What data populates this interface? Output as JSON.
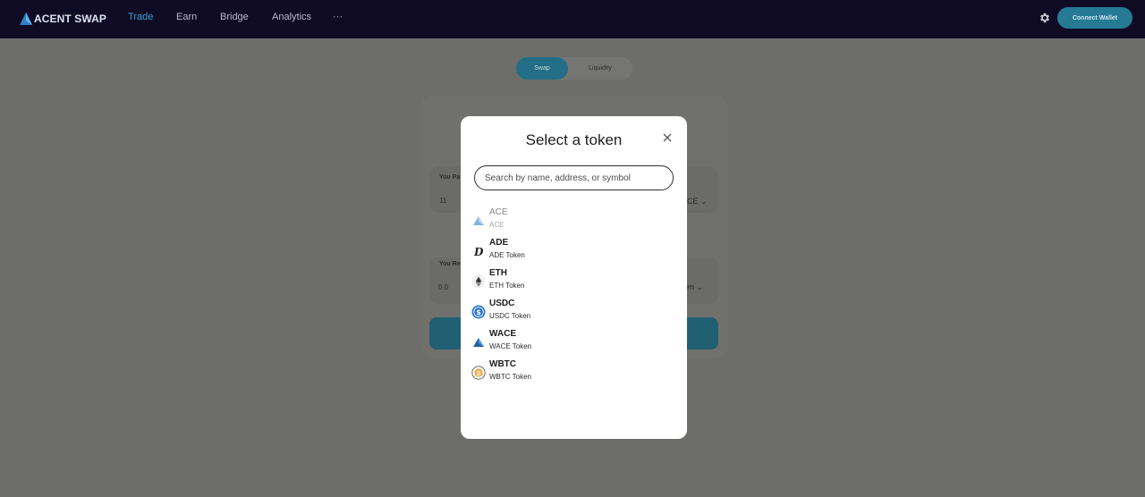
{
  "brand": {
    "name": "ACENT SWAP",
    "accent": "#3aa0d6"
  },
  "nav": {
    "links": [
      {
        "label": "Trade",
        "active": true
      },
      {
        "label": "Earn",
        "active": false
      },
      {
        "label": "Bridge",
        "active": false
      },
      {
        "label": "Analytics",
        "active": false
      },
      {
        "label": "···",
        "active": false
      }
    ],
    "connect_label": "Connect Wallet"
  },
  "page": {
    "tabs": [
      {
        "label": "Swap",
        "active": true
      },
      {
        "label": "Liquidity",
        "active": false
      }
    ],
    "pay_label": "You Pa",
    "pay_value": "11",
    "pay_token": "CE",
    "receive_label": "You Re",
    "receive_value": "0.0",
    "receive_token": "en"
  },
  "modal": {
    "title": "Select a token",
    "search_placeholder": "Search by name, address, or symbol",
    "tokens": [
      {
        "symbol": "ACE",
        "name": "ACE",
        "icon": "ace-icon",
        "disabled": true
      },
      {
        "symbol": "ADE",
        "name": "ADE Token",
        "icon": "ade-icon",
        "disabled": false
      },
      {
        "symbol": "ETH",
        "name": "ETH Token",
        "icon": "eth-icon",
        "disabled": false
      },
      {
        "symbol": "USDC",
        "name": "USDC Token",
        "icon": "usdc-icon",
        "disabled": false
      },
      {
        "symbol": "WACE",
        "name": "WACE Token",
        "icon": "wace-icon",
        "disabled": false
      },
      {
        "symbol": "WBTC",
        "name": "WBTC Token",
        "icon": "wbtc-icon",
        "disabled": false
      }
    ]
  }
}
